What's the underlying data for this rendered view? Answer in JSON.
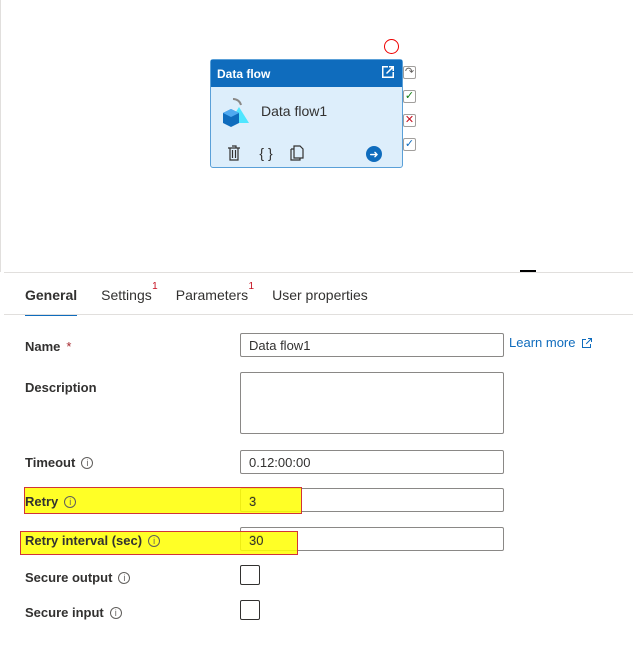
{
  "activity": {
    "type_label": "Data flow",
    "name": "Data flow1",
    "icons": [
      "delete-icon",
      "code-icon",
      "copy-icon",
      "go-arrow-icon"
    ]
  },
  "ports": {
    "skip": "↷",
    "success": "✓",
    "failure": "✕",
    "completion": "✓"
  },
  "tabs": [
    {
      "label": "General"
    },
    {
      "label": "Settings",
      "badge": "1"
    },
    {
      "label": "Parameters",
      "badge": "1"
    },
    {
      "label": "User properties"
    }
  ],
  "form": {
    "name": {
      "label": "Name",
      "required_mark": "*",
      "value": "Data flow1"
    },
    "learn_more": "Learn more",
    "description": {
      "label": "Description",
      "value": ""
    },
    "timeout": {
      "label": "Timeout",
      "value": "0.12:00:00"
    },
    "retry": {
      "label": "Retry",
      "value": "3"
    },
    "retry_interval": {
      "label": "Retry interval (sec)",
      "value": "30"
    },
    "secure_output": {
      "label": "Secure output",
      "checked": false
    },
    "secure_input": {
      "label": "Secure input",
      "checked": false
    }
  },
  "info_glyph": "i",
  "colors": {
    "accent": "#0f6cbd",
    "highlight": "#ffff00",
    "annotation": "#e00000"
  }
}
